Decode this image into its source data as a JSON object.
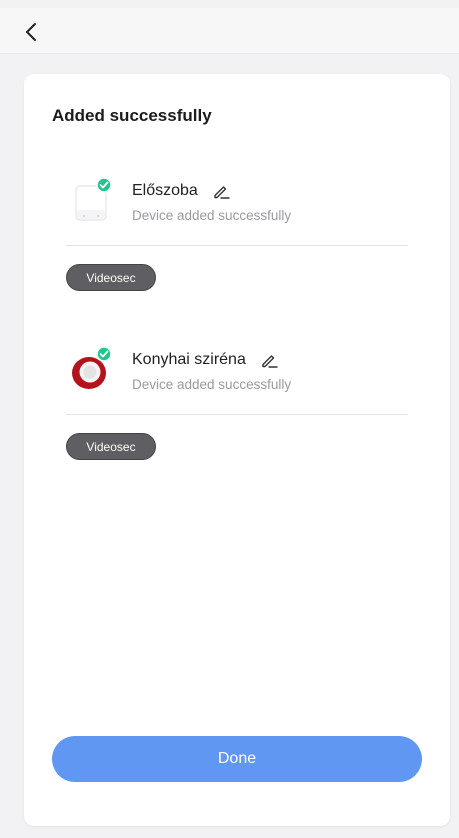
{
  "header": {
    "back_icon": "chevron-left-icon"
  },
  "title": "Added successfully",
  "devices": [
    {
      "name": "Előszoba",
      "status": "Device added successfully",
      "tag": "Videosec",
      "icon": "hub-device-icon"
    },
    {
      "name": "Konyhai sziréna",
      "status": "Device added successfully",
      "tag": "Videosec",
      "icon": "siren-device-icon"
    }
  ],
  "done_label": "Done",
  "colors": {
    "accent": "#5f97f3",
    "success": "#22c58b",
    "tag_bg": "#5f5f63"
  }
}
